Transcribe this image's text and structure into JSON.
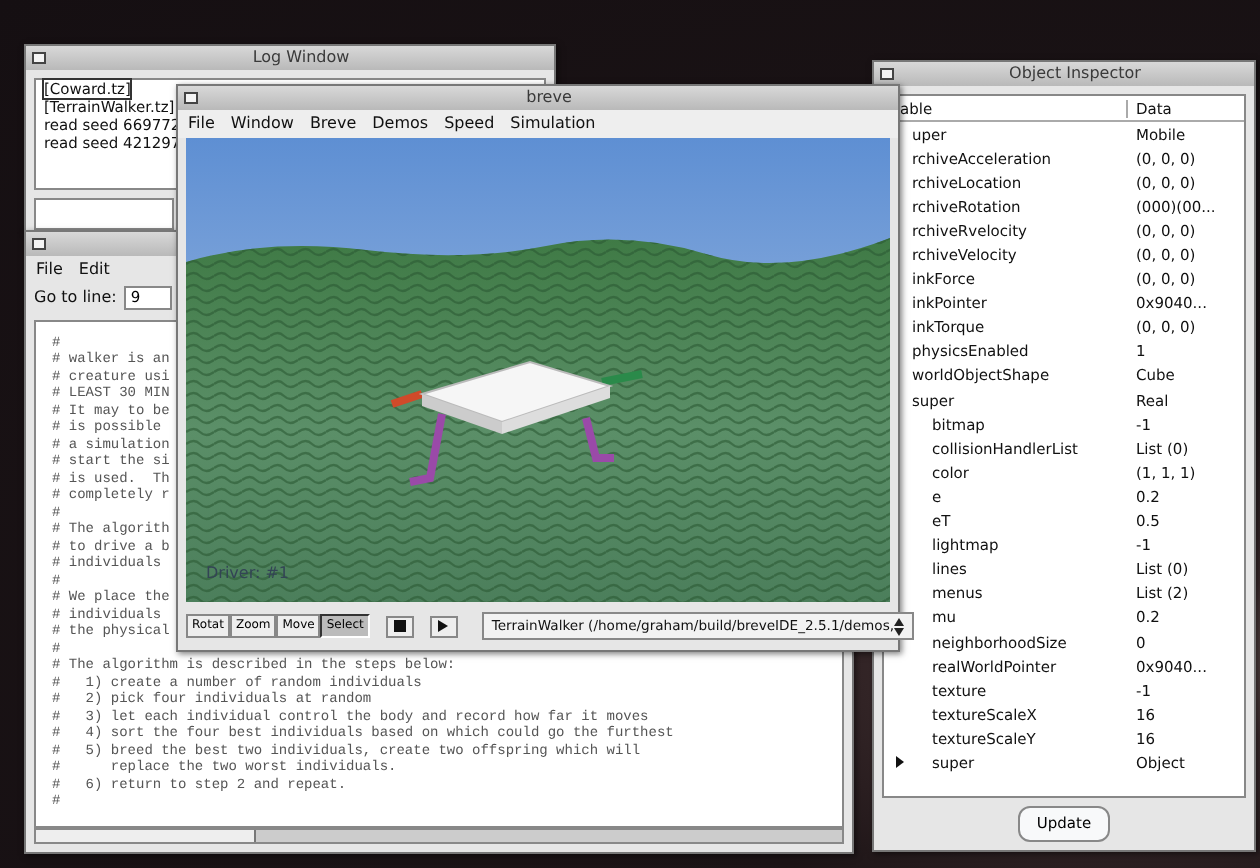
{
  "log_window": {
    "title": "Log Window",
    "lines": [
      {
        "text": "[Coward.tz]",
        "selected": true
      },
      {
        "text": "[TerrainWalker.tz]",
        "selected": false
      },
      {
        "text": "read seed 669772",
        "selected": false
      },
      {
        "text": "read seed 421297",
        "selected": false
      }
    ]
  },
  "editor_window": {
    "menu": [
      "File",
      "Edit"
    ],
    "goto": {
      "label": "Go to line:",
      "value": "9"
    },
    "code_lines": [
      "#",
      "# walker is an",
      "# creature usi",
      "# LEAST 30 MIN",
      "# It may to be",
      "# is possible",
      "# a simulation",
      "# start the si",
      "# is used.  Th",
      "# completely r",
      "#",
      "# The algorith",
      "# to drive a b",
      "# individuals",
      "#",
      "# We place the",
      "# individuals",
      "# the physical",
      "#",
      "# The algorithm is described in the steps below:",
      "#   1) create a number of random individuals",
      "#   2) pick four individuals at random",
      "#   3) let each individual control the body and record how far it moves",
      "#   4) sort the four best individuals based on which could go the furthest",
      "#   5) breed the best two individuals, create two offspring which will",
      "#      replace the two worst individuals.",
      "#   6) return to step 2 and repeat.",
      "#"
    ]
  },
  "breve_window": {
    "title": "breve",
    "menu": [
      "File",
      "Window",
      "Breve",
      "Demos",
      "Speed",
      "Simulation"
    ],
    "viewport": {
      "overlay": "Driver: #1"
    },
    "tools": [
      {
        "label": "Rotat",
        "selected": false
      },
      {
        "label": "Zoom",
        "selected": false
      },
      {
        "label": "Move",
        "selected": false
      },
      {
        "label": "Select",
        "selected": true
      }
    ],
    "transport": [
      {
        "kind": "stop"
      },
      {
        "kind": "play"
      }
    ],
    "simulation_select": {
      "value": "TerrainWalker (/home/graham/build/breveIDE_2.5.1/demos,"
    }
  },
  "inspector": {
    "title": "Object Inspector",
    "columns": [
      "able",
      "Data"
    ],
    "rows": [
      {
        "name": "uper",
        "value": "Mobile"
      },
      {
        "name": "rchiveAcceleration",
        "value": "(0, 0, 0)"
      },
      {
        "name": "rchiveLocation",
        "value": "(0, 0, 0)"
      },
      {
        "name": "rchiveRotation",
        "value": "(000)(00..."
      },
      {
        "name": "rchiveRvelocity",
        "value": "(0, 0, 0)"
      },
      {
        "name": "rchiveVelocity",
        "value": "(0, 0, 0)"
      },
      {
        "name": "inkForce",
        "value": "(0, 0, 0)"
      },
      {
        "name": "inkPointer",
        "value": "0x9040..."
      },
      {
        "name": "inkTorque",
        "value": "(0, 0, 0)"
      },
      {
        "name": "physicsEnabled",
        "value": "1"
      },
      {
        "name": "worldObjectShape",
        "value": "Cube"
      },
      {
        "name": "super",
        "value": "Real",
        "expanded": true,
        "children": [
          {
            "name": "bitmap",
            "value": "-1"
          },
          {
            "name": "collisionHandlerList",
            "value": "List (0)"
          },
          {
            "name": "color",
            "value": "(1, 1, 1)"
          },
          {
            "name": "e",
            "value": "0.2"
          },
          {
            "name": "eT",
            "value": "0.5"
          },
          {
            "name": "lightmap",
            "value": "-1"
          },
          {
            "name": "lines",
            "value": "List (0)"
          },
          {
            "name": "menus",
            "value": "List (2)"
          },
          {
            "name": "mu",
            "value": "0.2"
          },
          {
            "name": "neighborhoodSize",
            "value": "0"
          },
          {
            "name": "realWorldPointer",
            "value": "0x9040..."
          },
          {
            "name": "texture",
            "value": "-1"
          },
          {
            "name": "textureScaleX",
            "value": "16"
          },
          {
            "name": "textureScaleY",
            "value": "16"
          },
          {
            "name": "super",
            "value": "Object",
            "expanded": false
          }
        ]
      }
    ],
    "button": "Update"
  }
}
